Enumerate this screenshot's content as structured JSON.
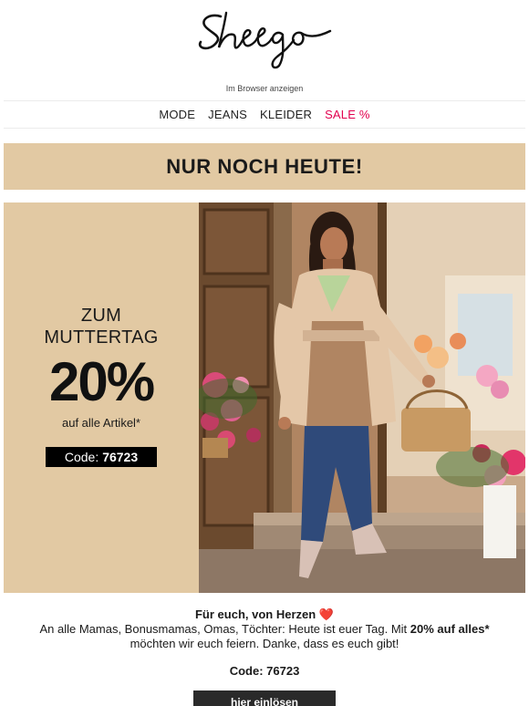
{
  "brand": {
    "logo_text": "Sheego"
  },
  "header": {
    "browser_link": "Im Browser anzeigen"
  },
  "nav": {
    "items": [
      {
        "label": "MODE"
      },
      {
        "label": "JEANS"
      },
      {
        "label": "KLEIDER"
      },
      {
        "label": "SALE %",
        "color": "#e2004f"
      }
    ]
  },
  "banner": {
    "text": "NUR NOCH HEUTE!",
    "background": "#e2c9a3"
  },
  "promo": {
    "line1": "ZUM",
    "line2": "MUTTERTAG",
    "discount": "20%",
    "subtitle": "auf alle Artikel*",
    "code_label": "Code:",
    "code_value": "76723"
  },
  "body": {
    "headline": "Für euch, von Herzen",
    "headline_icon": "heart-icon",
    "text_part1": "An alle Mamas, Bonusmamas, Omas, Töchter: Heute ist euer Tag. Mit ",
    "text_bold": "20% auf alles*",
    "text_part2": " möchten wir euch feiern. Danke, dass es euch gibt!",
    "code_line": "Code: 76723",
    "cta_label": "hier einlösen"
  }
}
